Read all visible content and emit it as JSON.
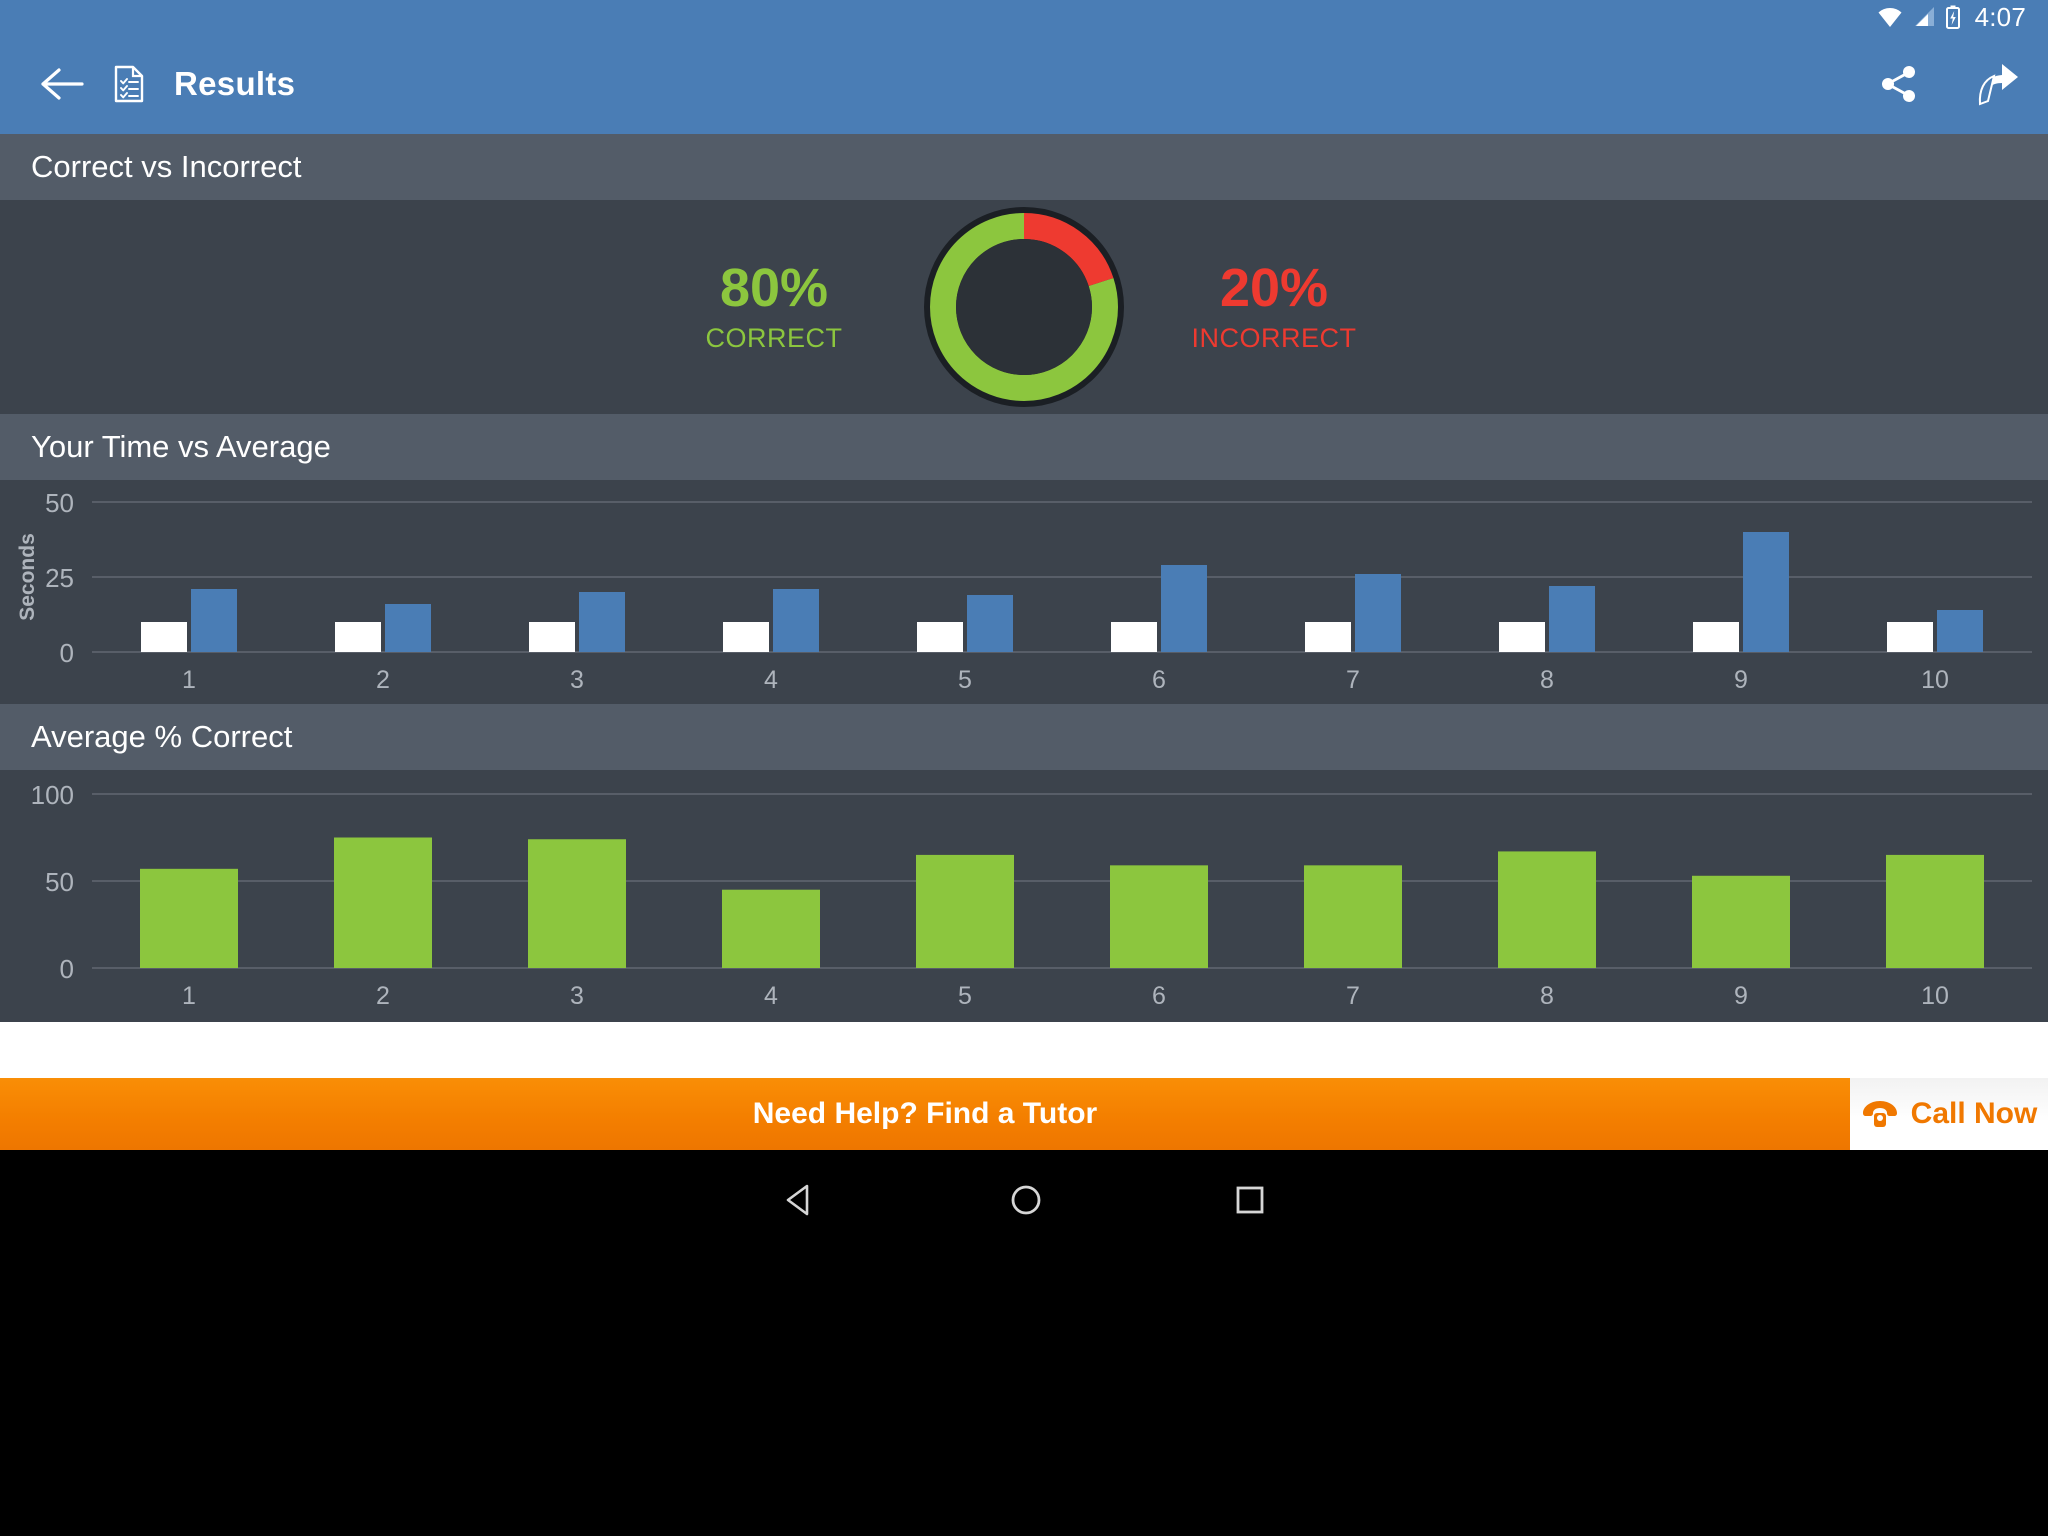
{
  "statusbar": {
    "time": "4:07",
    "icons": [
      "wifi-icon",
      "cell-signal-icon",
      "battery-charging-icon"
    ]
  },
  "appbar": {
    "title": "Results",
    "back_icon": "back-arrow-icon",
    "doc_icon": "results-document-icon",
    "share_icon": "share-icon",
    "send_icon": "send-forward-icon",
    "background_color": "#4A7DB5"
  },
  "sections": {
    "correct_vs_incorrect": {
      "title": "Correct vs Incorrect"
    },
    "time_vs_average": {
      "title": "Your Time vs Average"
    },
    "average_correct": {
      "title": "Average % Correct"
    }
  },
  "donut": {
    "correct_value": "80%",
    "correct_label": "CORRECT",
    "incorrect_value": "20%",
    "incorrect_label": "INCORRECT",
    "correct_color": "#8CC63E",
    "incorrect_color": "#EE3A30",
    "hole_color": "#2C3137",
    "ring_outline": "#1B1F24"
  },
  "colors": {
    "panel_bg": "#3C434C",
    "header_bg": "#535C68",
    "blue_bar": "#4A7DB5",
    "white_bar": "#FFFFFF",
    "green_bar": "#8CC63E",
    "gridline": "#6E757E",
    "axis_text": "#AEB4BC",
    "orange": "#F47F00"
  },
  "ad": {
    "banner_text": "Need Help? Find a Tutor",
    "call_text": "Call Now",
    "phone_icon": "telephone-icon"
  },
  "navbar": {
    "back": "triangle-back-icon",
    "home": "circle-home-icon",
    "recents": "square-recents-icon"
  },
  "chart_data": [
    {
      "type": "bar",
      "title": "Your Time vs Average",
      "xlabel": "",
      "ylabel": "Seconds",
      "categories": [
        "1",
        "2",
        "3",
        "4",
        "5",
        "6",
        "7",
        "8",
        "9",
        "10"
      ],
      "yticks": [
        0,
        25,
        50
      ],
      "ylim": [
        0,
        50
      ],
      "grid": true,
      "legend": "none",
      "series": [
        {
          "name": "Average",
          "color": "#FFFFFF",
          "values": [
            10,
            10,
            10,
            10,
            10,
            10,
            10,
            10,
            10,
            10
          ]
        },
        {
          "name": "Your Time",
          "color": "#4A7DB5",
          "values": [
            21,
            16,
            20,
            21,
            19,
            29,
            26,
            22,
            40,
            14
          ]
        }
      ]
    },
    {
      "type": "bar",
      "title": "Average % Correct",
      "xlabel": "",
      "ylabel": "",
      "categories": [
        "1",
        "2",
        "3",
        "4",
        "5",
        "6",
        "7",
        "8",
        "9",
        "10"
      ],
      "yticks": [
        0,
        50,
        100
      ],
      "ylim": [
        0,
        100
      ],
      "grid": true,
      "legend": "none",
      "series": [
        {
          "name": "Average % Correct",
          "color": "#8CC63E",
          "values": [
            57,
            75,
            74,
            45,
            65,
            59,
            59,
            67,
            53,
            65
          ]
        }
      ]
    }
  ]
}
